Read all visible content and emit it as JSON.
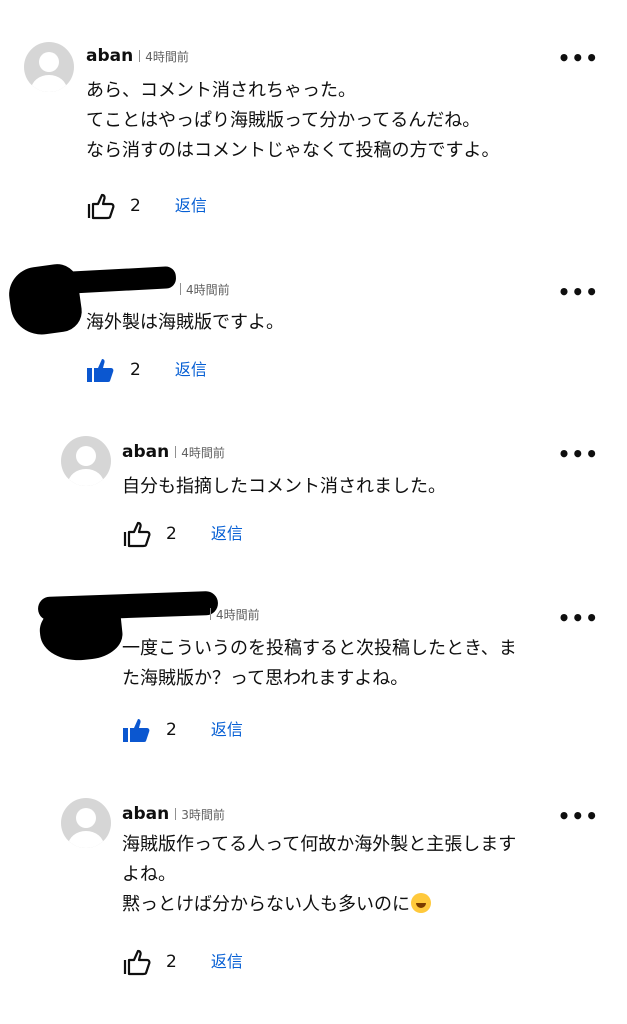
{
  "icons": {
    "like_outline": "thumbs-up-outline-icon",
    "like_filled": "thumbs-up-filled-icon",
    "more": "more-vert-icon",
    "emoji": "rolling-on-floor-laughing-emoji"
  },
  "colors": {
    "like_active": "#0b57d0",
    "reply": "#065fd4",
    "avatar": "#d6d6d6"
  },
  "comments": [
    {
      "author": "aban",
      "time": "4時間前",
      "more": "•••",
      "lines": [
        "あら、コメント消されちゃった。",
        "てことはやっぱり海賊版って分かってるんだね。",
        "なら消すのはコメントじゃなくて投稿の方ですよ。"
      ],
      "liked": false,
      "likes": "2",
      "reply": "返信"
    },
    {
      "author": "",
      "time": "4時間前",
      "more": "•••",
      "lines": [
        "海外製は海賊版ですよ。"
      ],
      "liked": true,
      "likes": "2",
      "reply": "返信"
    },
    {
      "author": "aban",
      "time": "4時間前",
      "more": "•••",
      "lines": [
        "自分も指摘したコメント消されました。"
      ],
      "liked": false,
      "likes": "2",
      "reply": "返信"
    },
    {
      "author": "",
      "time": "4時間前",
      "more": "•••",
      "lines": [
        "一度こういうのを投稿すると次投稿したとき、ま",
        "た海賊版か？って思われますよね。"
      ],
      "liked": true,
      "likes": "2",
      "reply": "返信"
    },
    {
      "author": "aban",
      "time": "3時間前",
      "more": "•••",
      "lines": [
        "海賊版作ってる人って何故か海外製と主張します",
        "よね。",
        "黙っとけば分からない人も多いのに"
      ],
      "liked": false,
      "likes": "2",
      "reply": "返信"
    }
  ]
}
